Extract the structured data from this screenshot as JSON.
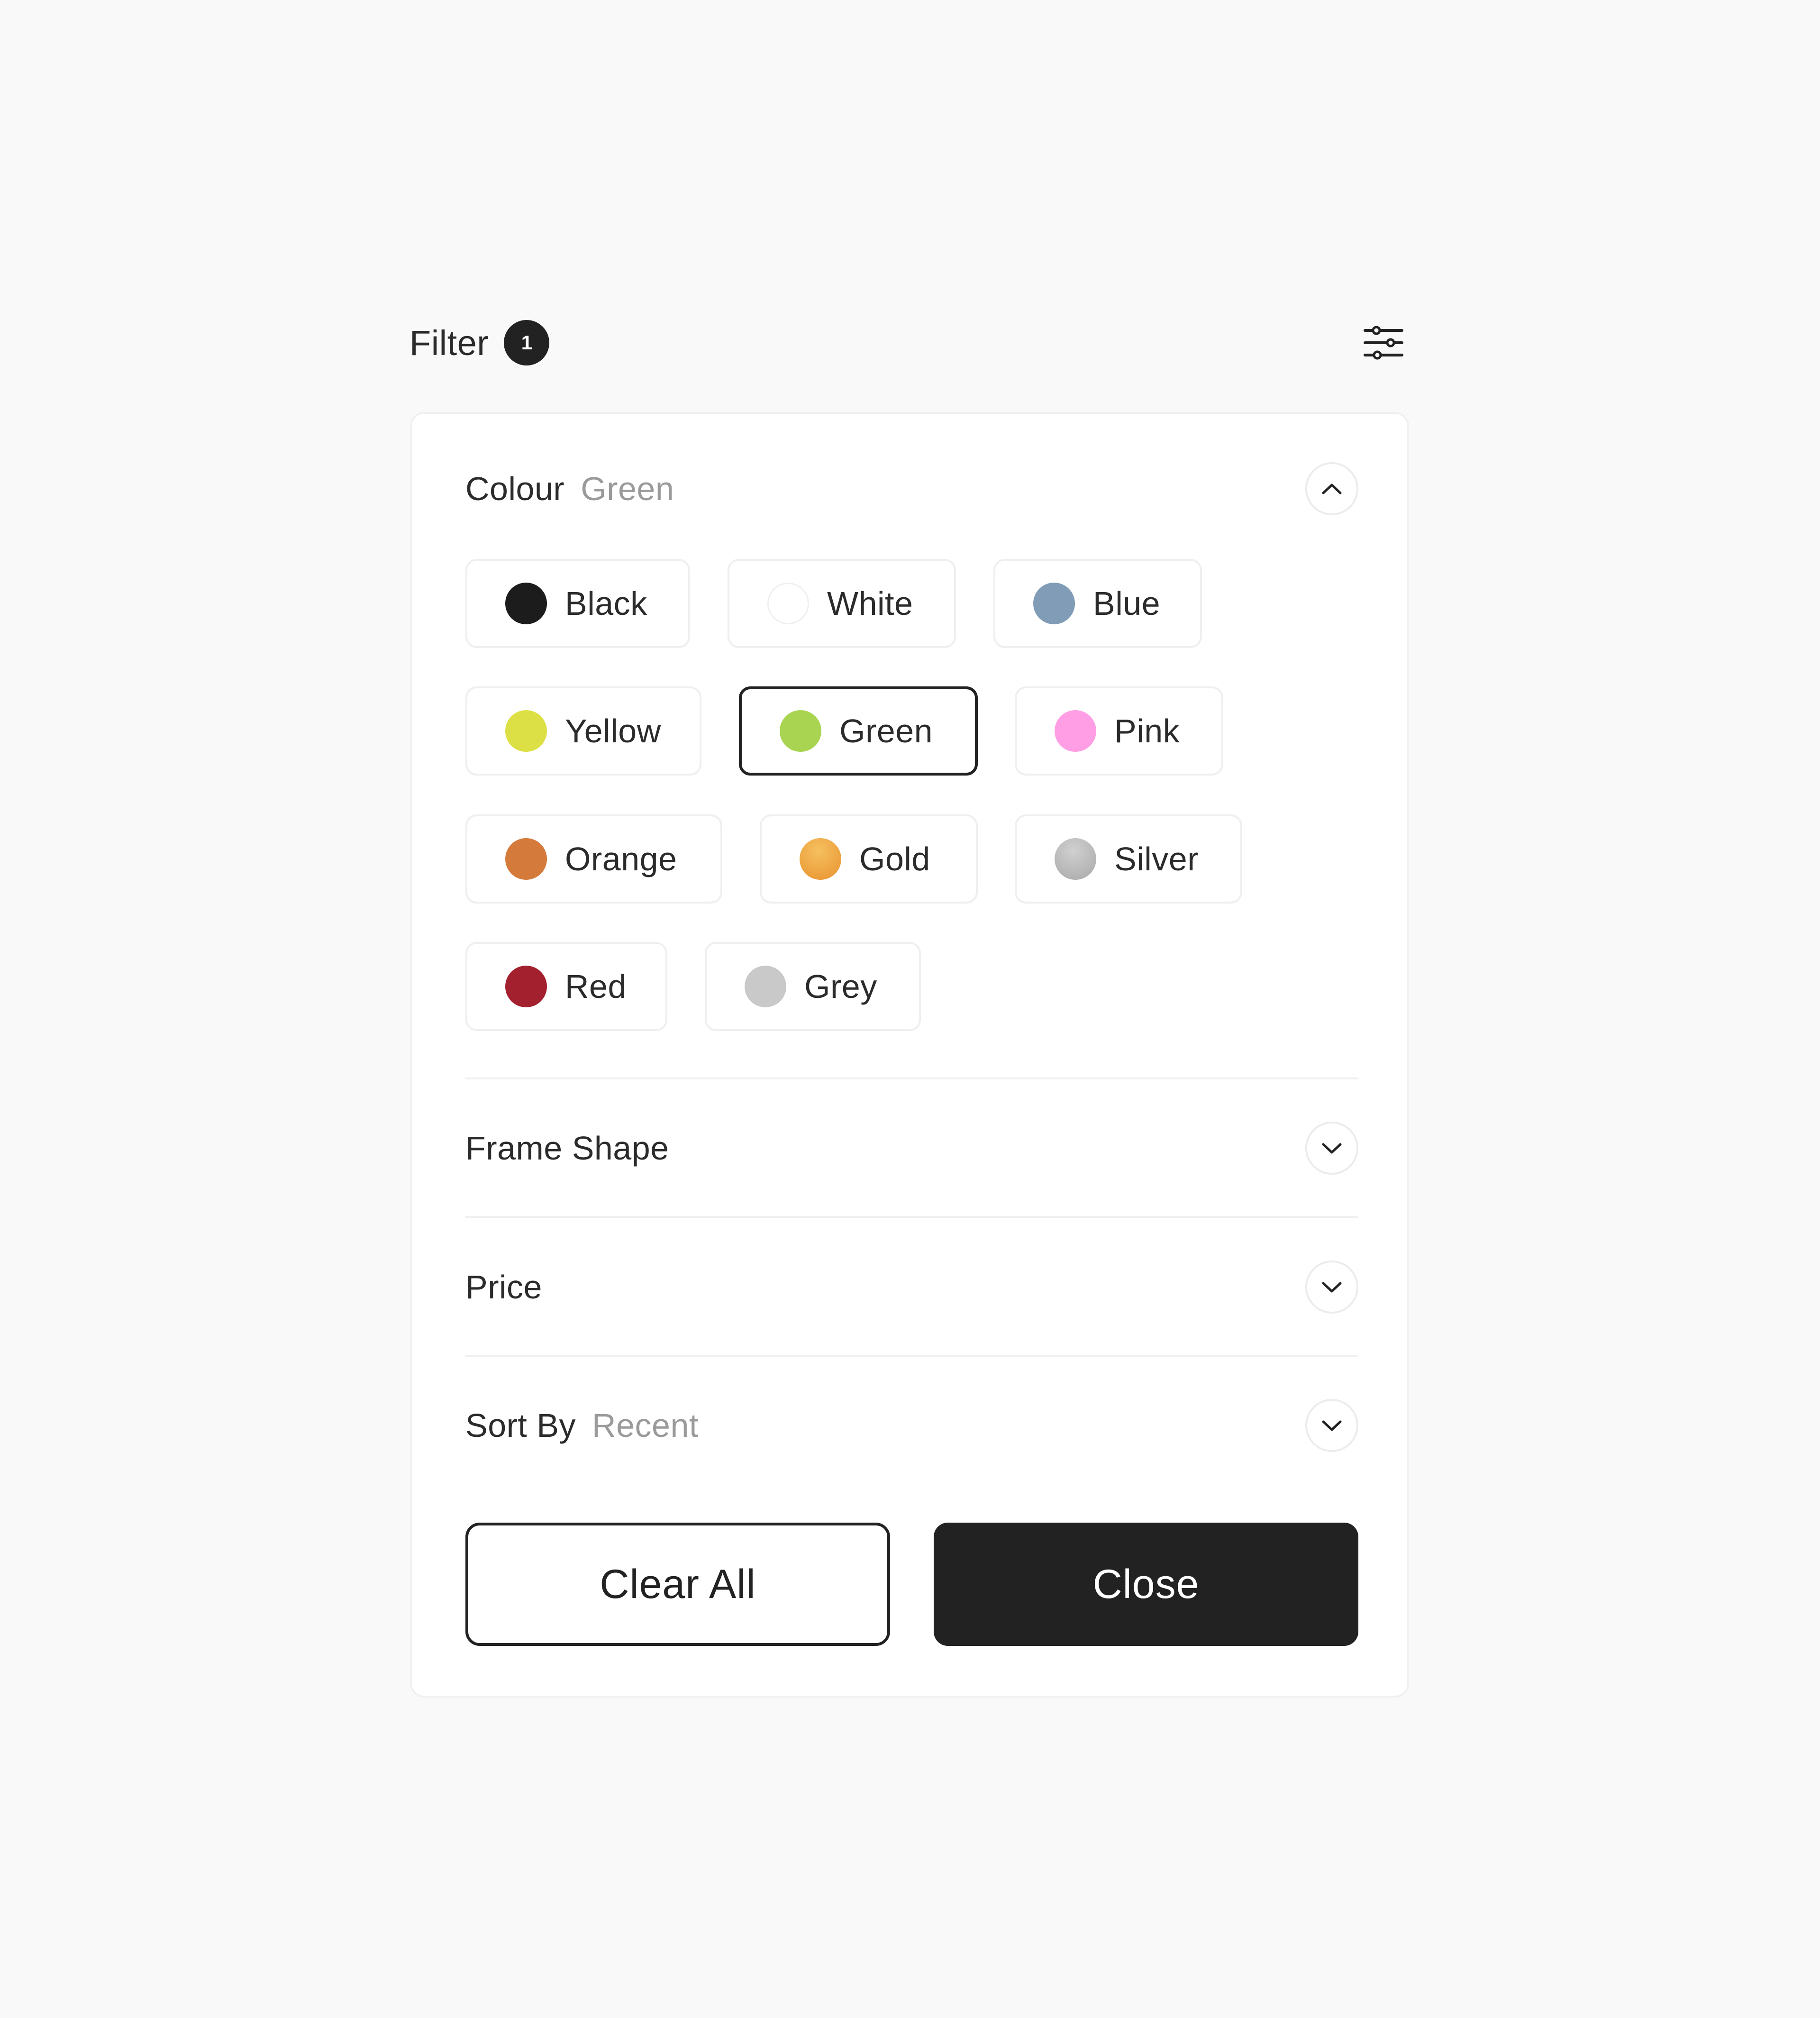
{
  "header": {
    "title": "Filter",
    "badge_count": "1"
  },
  "icons": {
    "settings": "sliders-icon",
    "toggle_open": "chevron-up-icon",
    "toggle_closed": "chevron-down-icon"
  },
  "sections": {
    "colour": {
      "label": "Colour",
      "value": "Green",
      "expanded": true
    },
    "frame_shape": {
      "label": "Frame Shape",
      "expanded": false
    },
    "price": {
      "label": "Price",
      "expanded": false
    },
    "sort_by": {
      "label": "Sort By",
      "value": "Recent",
      "expanded": false
    }
  },
  "colours": [
    {
      "label": "Black",
      "hex": "#1c1c1c"
    },
    {
      "label": "White",
      "hex": "#ffffff"
    },
    {
      "label": "Blue",
      "hex": "#809cb6"
    },
    {
      "label": "Yellow",
      "hex": "#dde044"
    },
    {
      "label": "Green",
      "hex": "#a9d451",
      "selected": true
    },
    {
      "label": "Pink",
      "hex": "#ff9ee5"
    },
    {
      "label": "Orange",
      "hex": "#d47a3a"
    },
    {
      "label": "Gold",
      "hex": "#eea03a"
    },
    {
      "label": "Silver",
      "hex": "#b3b3b3"
    },
    {
      "label": "Red",
      "hex": "#a3212f"
    },
    {
      "label": "Grey",
      "hex": "#c9c9c9"
    }
  ],
  "actions": {
    "clear_all": "Clear All",
    "close": "Close"
  },
  "theme": {
    "background": "#f9f9f9",
    "primary": "#222222",
    "muted_text": "#9a9a9a"
  }
}
